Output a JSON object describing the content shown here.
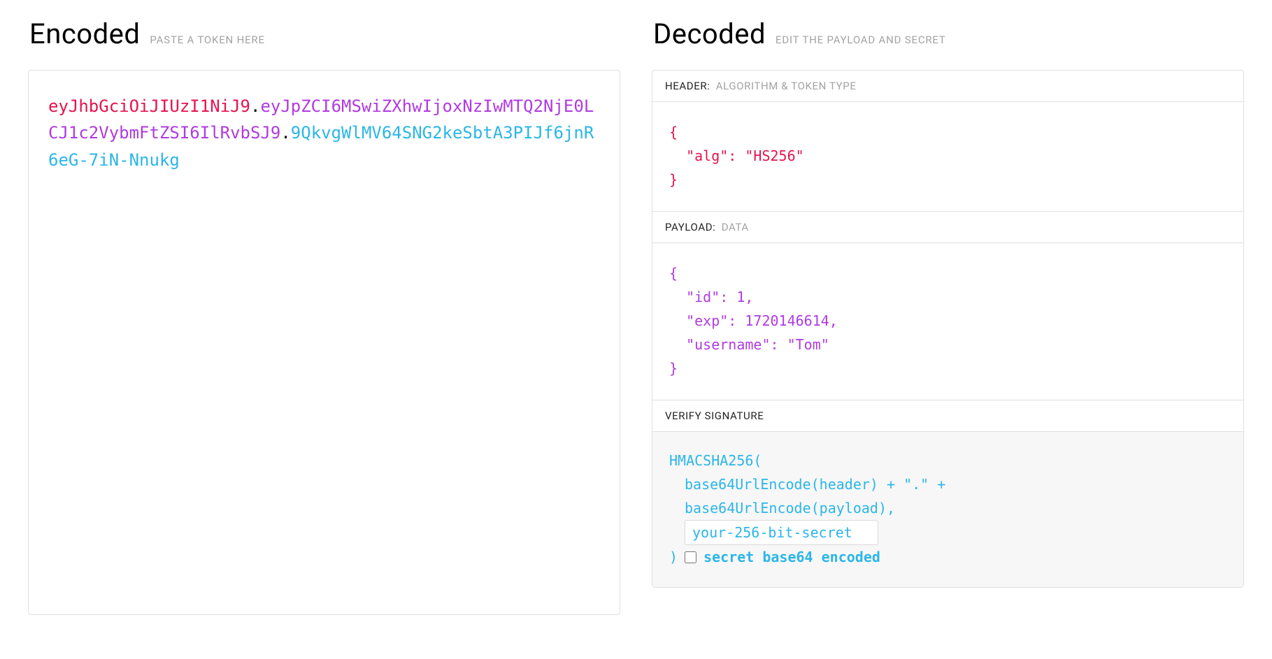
{
  "encoded": {
    "title": "Encoded",
    "hint": "PASTE A TOKEN HERE",
    "token_header": "eyJhbGciOiJIUzI1NiJ9",
    "token_payload": "eyJpZCI6MSwiZXhwIjoxNzIwMTQ2NjE0LCJ1c2VybmFtZSI6IlRvbSJ9",
    "token_signature": "9QkvgWlMV64SNG2keSbtA3PIJf6jnR6eG-7iN-Nnukg"
  },
  "decoded": {
    "title": "Decoded",
    "hint": "EDIT THE PAYLOAD AND SECRET",
    "header_section": {
      "label": "HEADER:",
      "sub": "ALGORITHM & TOKEN TYPE",
      "content": "{\n  \"alg\": \"HS256\"\n}"
    },
    "payload_section": {
      "label": "PAYLOAD:",
      "sub": "DATA",
      "content": "{\n  \"id\": 1,\n  \"exp\": 1720146614,\n  \"username\": \"Tom\"\n}"
    },
    "signature_section": {
      "label": "VERIFY SIGNATURE",
      "line1": "HMACSHA256(",
      "line2": "base64UrlEncode(header) + \".\" +",
      "line3": "base64UrlEncode(payload),",
      "secret_value": "your-256-bit-secret",
      "close_paren": ") ",
      "checkbox_label": "secret base64 encoded"
    }
  }
}
